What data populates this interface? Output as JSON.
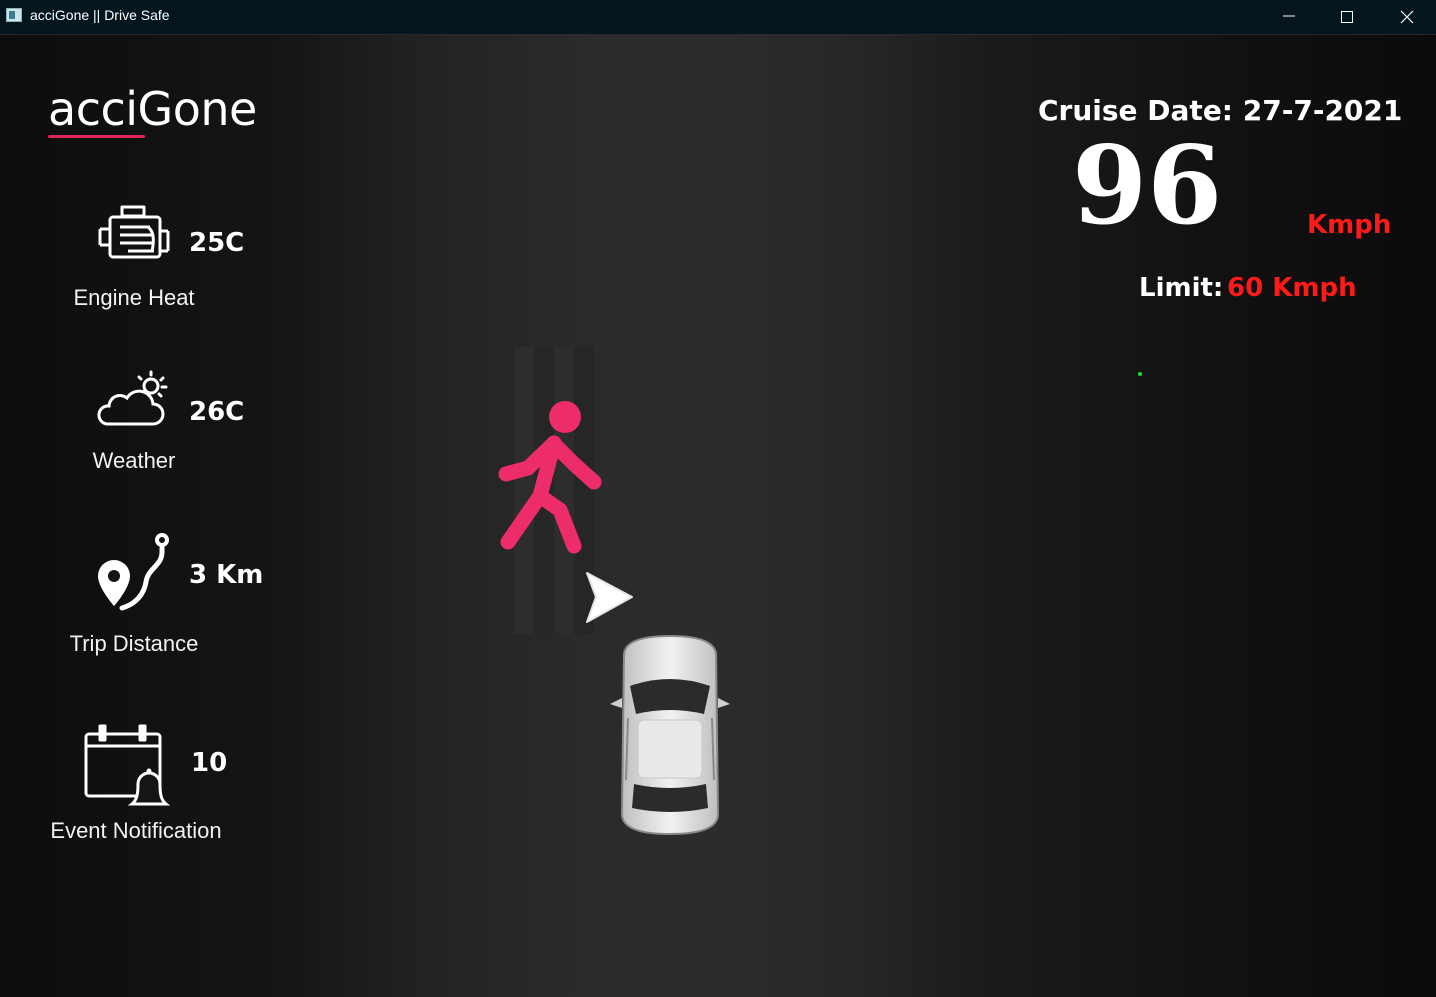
{
  "window": {
    "title": "acciGone || Drive Safe"
  },
  "logo": {
    "text": "acciGone"
  },
  "stats": {
    "engine_heat": {
      "value": "25C",
      "label": "Engine Heat",
      "icon": "engine-icon"
    },
    "weather": {
      "value": "26C",
      "label": "Weather",
      "icon": "cloud-sun-icon"
    },
    "trip_distance": {
      "value": "3 Km",
      "label": "Trip Distance",
      "icon": "route-pin-icon"
    },
    "event_notification": {
      "value": "10",
      "label": "Event Notification",
      "icon": "calendar-bell-icon"
    }
  },
  "cruise": {
    "date_text": "Cruise Date: 27-7-2021",
    "speed": "96",
    "speed_unit": "Kmph",
    "limit_label": "Limit:",
    "limit_value": "60 Kmph"
  },
  "scene": {
    "pedestrian_icon": "pedestrian-walking-icon",
    "direction_icon": "direction-arrow-icon",
    "car_icon": "car-top-view-icon"
  },
  "colors": {
    "accent": "#e0255a",
    "pedestrian": "#ec2d6a",
    "speed_unit": "#ff1a1a",
    "indicator_dot": "#22dd22"
  }
}
